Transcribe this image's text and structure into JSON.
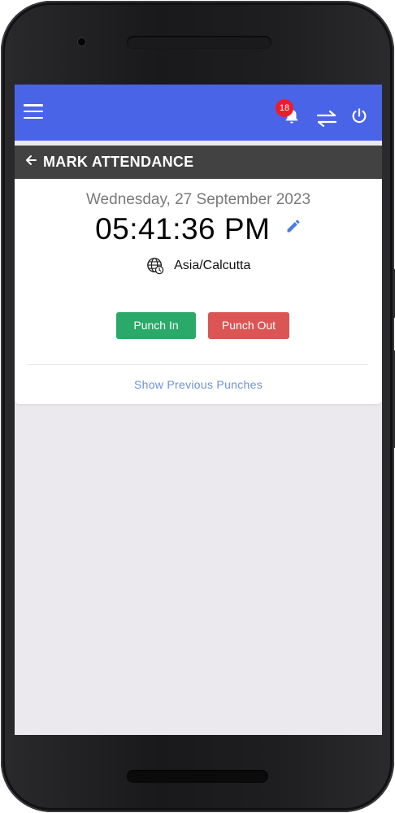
{
  "app_bar": {
    "notification_count": "18",
    "icons": [
      "menu-icon",
      "bell-icon",
      "swap-icon",
      "power-icon"
    ],
    "color": "#4a64e8",
    "badge_color": "#ee1c2b"
  },
  "sub_header": {
    "title": "MARK ATTENDANCE",
    "back_icon": "arrow-left-icon"
  },
  "attendance": {
    "date": "Wednesday, 27 September 2023",
    "time": "05:41:36 PM",
    "timezone": "Asia/Calcutta",
    "punch_in_label": "Punch In",
    "punch_out_label": "Punch Out",
    "previous_punches_label": "Show Previous Punches",
    "punch_in_color": "#2aa968",
    "punch_out_color": "#dc5555"
  }
}
